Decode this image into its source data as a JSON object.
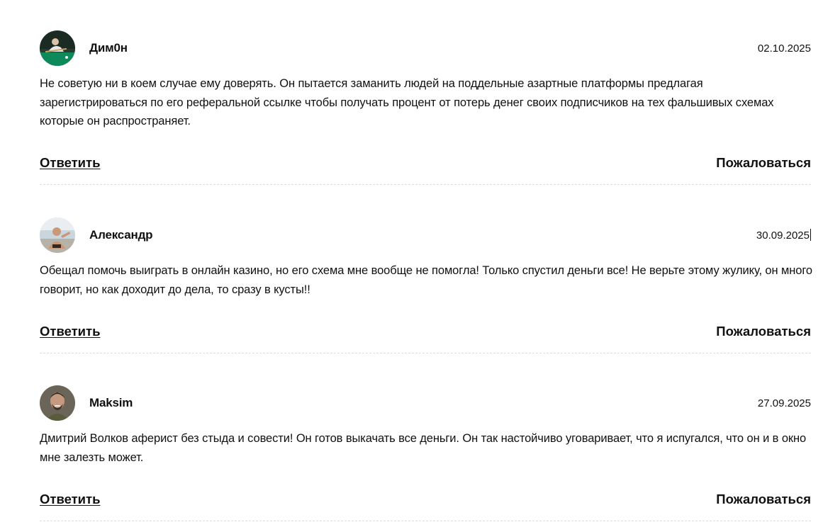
{
  "comments": [
    {
      "author": "Дим0н",
      "date": "02.10.2025",
      "avatar_icon": "avatar-billiards-photo",
      "text": "Не советую ни в коем случае ему доверять. Он пытается заманить людей на поддельные азартные платформы предлагая зарегистрироваться по его реферальной ссылке чтобы получать процент от потерь денег своих подписчиков на тех фальшивых схемах которые он распространяет.",
      "reply_label": "Ответить",
      "report_label": "Пожаловаться"
    },
    {
      "author": "Александр",
      "date": "30.09.2025",
      "avatar_icon": "avatar-beach-photo",
      "text": "Обещал помочь выиграть в онлайн казино, но его схема мне вообще не помогла! Только спустил деньги все! Не верьте этому жулику, он много говорит, но как доходит до дела, то сразу в кусты!!",
      "reply_label": "Ответить",
      "report_label": "Пожаловаться"
    },
    {
      "author": "Maksim",
      "date": "27.09.2025",
      "avatar_icon": "avatar-portrait-photo",
      "text": "Дмитрий Волков аферист без стыда и совести! Он готов выкачать все деньги. Он так настойчиво уговаривает, что я испугался, что он и в окно мне залезть может.",
      "reply_label": "Ответить",
      "report_label": "Пожаловаться"
    }
  ],
  "colors": {
    "text": "#111111",
    "divider": "#dcdcdc",
    "background": "#ffffff"
  }
}
